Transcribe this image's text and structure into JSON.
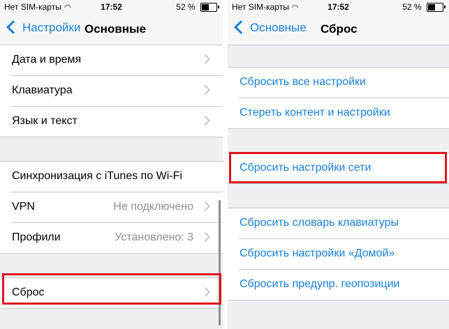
{
  "left": {
    "status": {
      "carrier": "Нет SIM-карты",
      "time": "17:52",
      "battery": "52 %",
      "battery_level": 0.52
    },
    "nav": {
      "back_label": "Настройки",
      "title": "Основные"
    },
    "groups": [
      {
        "items": [
          {
            "label": "Дата и время"
          },
          {
            "label": "Клавиатура"
          },
          {
            "label": "Язык и текст"
          }
        ]
      },
      {
        "items": [
          {
            "label": "Синхронизация с iTunes по Wi-Fi"
          },
          {
            "label": "VPN",
            "value": "Не подключено"
          },
          {
            "label": "Профили",
            "value": "Установлено: 3"
          }
        ]
      },
      {
        "items": [
          {
            "label": "Сброс"
          }
        ]
      }
    ]
  },
  "right": {
    "status": {
      "carrier": "Нет SIM-карты",
      "time": "17:52",
      "battery": "52 %",
      "battery_level": 0.52
    },
    "nav": {
      "back_label": "Основные",
      "title": "Сброс"
    },
    "groups": [
      {
        "items": [
          {
            "label": "Сбросить все настройки"
          },
          {
            "label": "Стереть контент и настройки"
          }
        ]
      },
      {
        "items": [
          {
            "label": "Сбросить настройки сети"
          }
        ]
      },
      {
        "items": [
          {
            "label": "Сбросить словарь клавиатуры"
          },
          {
            "label": "Сбросить настройки «Домой»"
          },
          {
            "label": "Сбросить предупр. геопозиции"
          }
        ]
      }
    ]
  },
  "colors": {
    "accent": "#1a7fd6",
    "highlight": "#e1141e",
    "background": "#efeff4"
  }
}
